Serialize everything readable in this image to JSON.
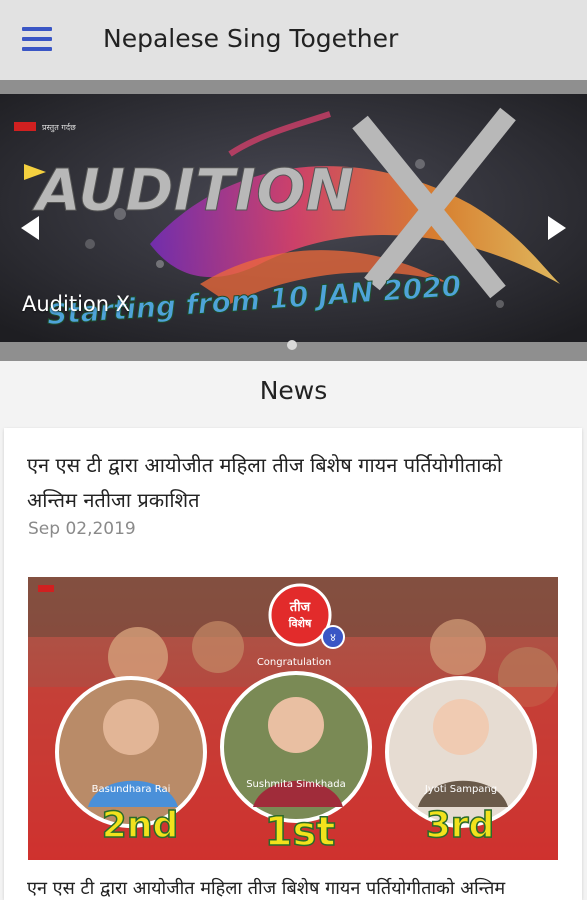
{
  "appbar": {
    "title": "Nepalese Sing Together",
    "menu_icon": "hamburger-menu-icon"
  },
  "banner": {
    "caption": "Audition X",
    "art_title": "AUDITION",
    "art_x": "X",
    "art_tagline": "Starting from 10 JAN 2020",
    "prev_icon": "chevron-left-icon",
    "next_icon": "chevron-right-icon",
    "slide_count": 1,
    "active_slide": 1
  },
  "news": {
    "heading": "News",
    "article": {
      "title": "एन एस टी द्वारा आयोजीत महिला तीज बिशेष गायन पर्तियोगीताको अन्तिम नतीजा प्रकाशित",
      "date": "Sep 02,2019",
      "image": {
        "badge_line1": "तीज",
        "badge_line2": "विशेष",
        "badge_number": "४",
        "congrats": "Congratulation",
        "winners": [
          {
            "name": "Basundhara Rai",
            "place": "2nd"
          },
          {
            "name": "Sushmita Simkhada",
            "place": "1st"
          },
          {
            "name": "Jyoti Sampang",
            "place": "3rd"
          }
        ]
      },
      "excerpt": "एन एस टी द्वारा आयोजीत महिला तीज बिशेष गायन पर्तियोगीताको अन्तिम"
    }
  },
  "colors": {
    "accent": "#3a56c5",
    "appbar_bg": "#e2e2e2",
    "place_gold": "#f2e21c"
  }
}
